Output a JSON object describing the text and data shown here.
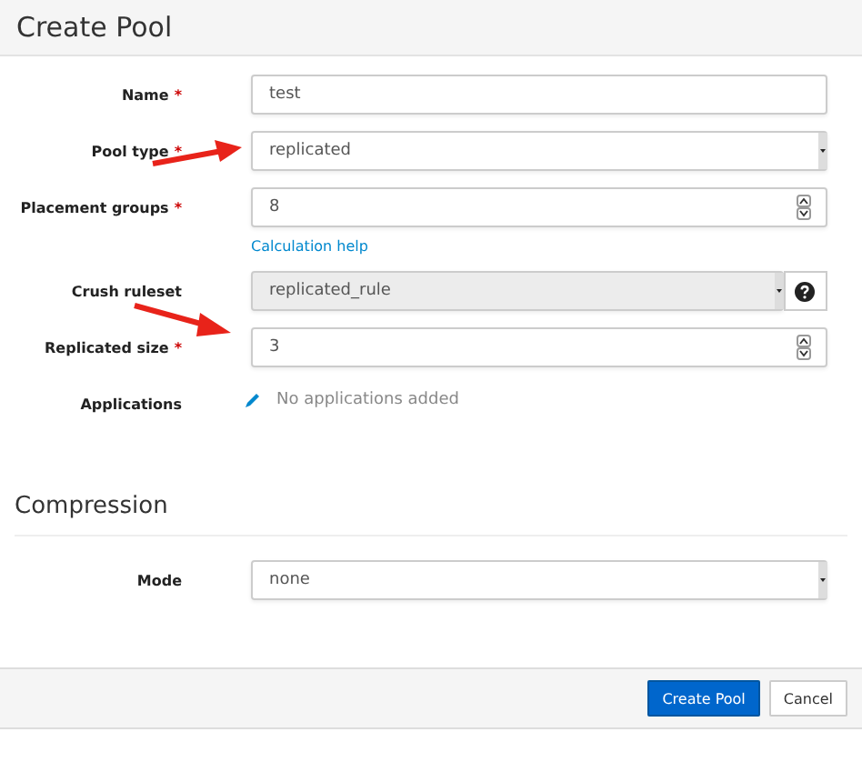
{
  "title": "Create Pool",
  "fields": [
    {
      "label": "Name",
      "required_mark": "*",
      "kind": "text",
      "value": "test"
    },
    {
      "label": "Pool type",
      "required_mark": "*",
      "kind": "select",
      "value": "replicated",
      "disabled": false
    },
    {
      "label": "Placement groups",
      "required_mark": "*",
      "kind": "number",
      "value": "8",
      "help_link": "Calculation help"
    },
    {
      "label": "Crush ruleset",
      "kind": "select",
      "value": "replicated_rule",
      "disabled": true,
      "help_button": true
    },
    {
      "label": "Replicated size",
      "required_mark": "*",
      "kind": "number",
      "value": "3"
    },
    {
      "label": "Applications",
      "kind": "apps",
      "value": "No applications added"
    }
  ],
  "compression": {
    "heading": "Compression",
    "fields": [
      {
        "label": "Mode",
        "kind": "select",
        "value": "none",
        "disabled": false
      }
    ]
  },
  "buttons": [
    {
      "label": "Create Pool",
      "primary": true
    },
    {
      "label": "Cancel",
      "primary": false
    }
  ]
}
